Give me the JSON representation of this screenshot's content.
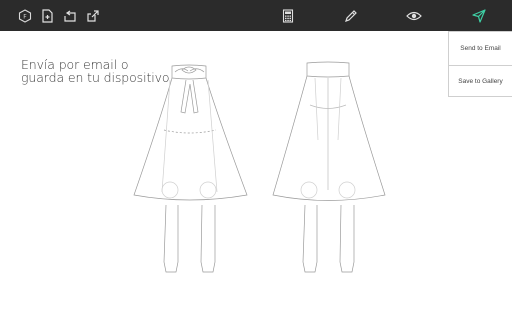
{
  "toolbar": {
    "background": "#2b2b2b",
    "icons": [
      "logo-hexagon-icon",
      "new-file-icon",
      "import-icon",
      "share-icon",
      "calculator-icon",
      "pencil-icon",
      "eye-icon",
      "send-icon"
    ],
    "send_icon_color": "#3ecfa4"
  },
  "canvas": {
    "hint_line1": "Envía por email o",
    "hint_line2": "guarda en tu dispositivo"
  },
  "share_menu": {
    "send_email_label": "Send to Email",
    "save_gallery_label": "Save to Gallery"
  }
}
